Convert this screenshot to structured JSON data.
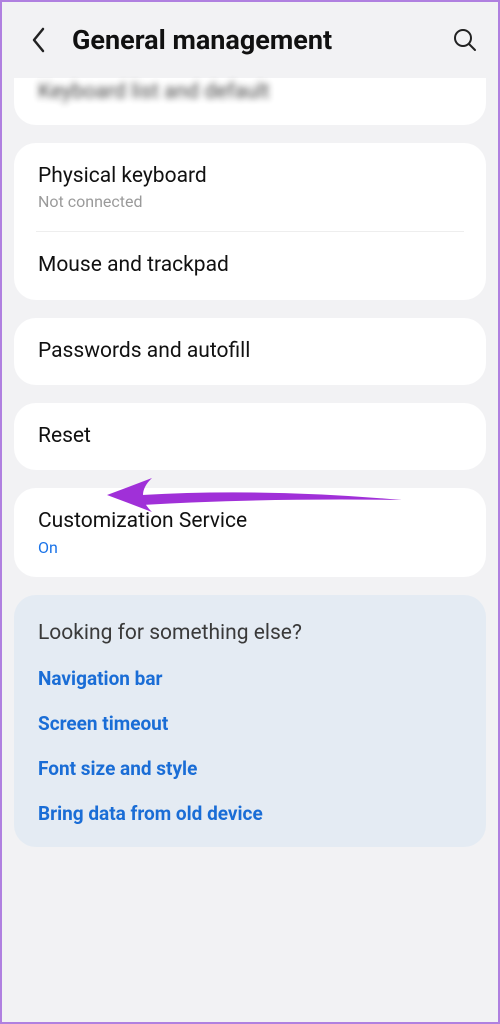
{
  "header": {
    "title": "General management"
  },
  "partial_item": {
    "label": "Keyboard list and default"
  },
  "group1": {
    "items": [
      {
        "title": "Physical keyboard",
        "subtitle": "Not connected"
      },
      {
        "title": "Mouse and trackpad"
      }
    ]
  },
  "group2": {
    "items": [
      {
        "title": "Passwords and autofill"
      }
    ]
  },
  "group3": {
    "items": [
      {
        "title": "Reset"
      }
    ]
  },
  "group4": {
    "items": [
      {
        "title": "Customization Service",
        "status": "On"
      }
    ]
  },
  "suggestions": {
    "heading": "Looking for something else?",
    "links": [
      "Navigation bar",
      "Screen timeout",
      "Font size and style",
      "Bring data from old device"
    ]
  },
  "annotation": {
    "color": "#a030d8"
  }
}
